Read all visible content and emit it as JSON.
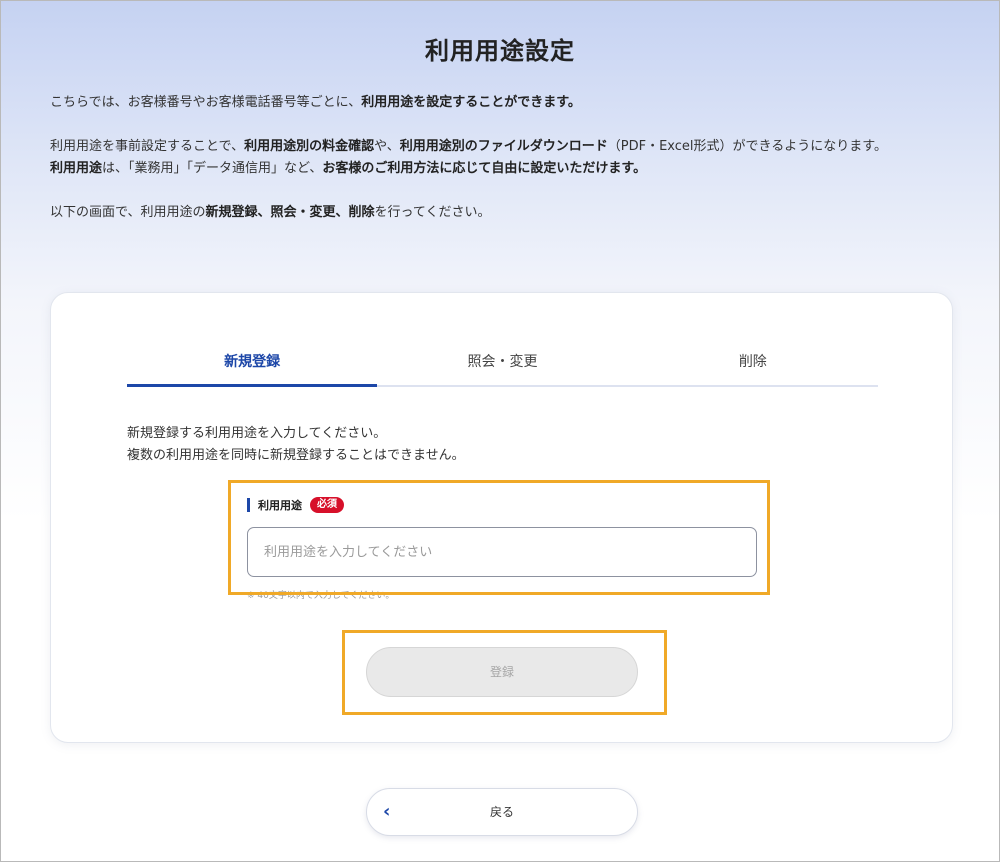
{
  "page": {
    "title": "利用用途設定"
  },
  "intro": {
    "line1_a": "こちらでは、お客様番号やお客様電話番号等ごとに、",
    "line1_b": "利用用途を設定することができます。",
    "line2_a": "利用用途を事前設定することで、",
    "line2_b": "利用用途別の料金確認",
    "line2_c": "や、",
    "line2_d": "利用用途別のファイルダウンロード",
    "line2_e": "（PDF・Excel形式）ができるようになります。",
    "line3_a": "利用用途",
    "line3_b": "は、「業務用」「データ通信用」など、",
    "line3_c": "お客様のご利用方法に応じて自由に設定いただけます。",
    "line4_a": "以下の画面で、利用用途の",
    "line4_b": "新規登録、照会・変更、削除",
    "line4_c": "を行ってください。"
  },
  "tabs": [
    {
      "label": "新規登録",
      "active": true
    },
    {
      "label": "照会・変更",
      "active": false
    },
    {
      "label": "削除",
      "active": false
    }
  ],
  "form": {
    "desc_line1": "新規登録する利用用途を入力してください。",
    "desc_line2": "複数の利用用途を同時に新規登録することはできません。",
    "field_label": "利用用途",
    "required_badge": "必須",
    "input_value": "",
    "input_placeholder": "利用用途を入力してください",
    "note": "※ 40文字以内で入力してください。",
    "register_label": "登録"
  },
  "footer": {
    "back_label": "戻る"
  },
  "colors": {
    "accent": "#1d47a8",
    "required": "#d7102a",
    "highlight": "#f0a928"
  },
  "icons": {
    "back": "chevron-left-icon"
  }
}
